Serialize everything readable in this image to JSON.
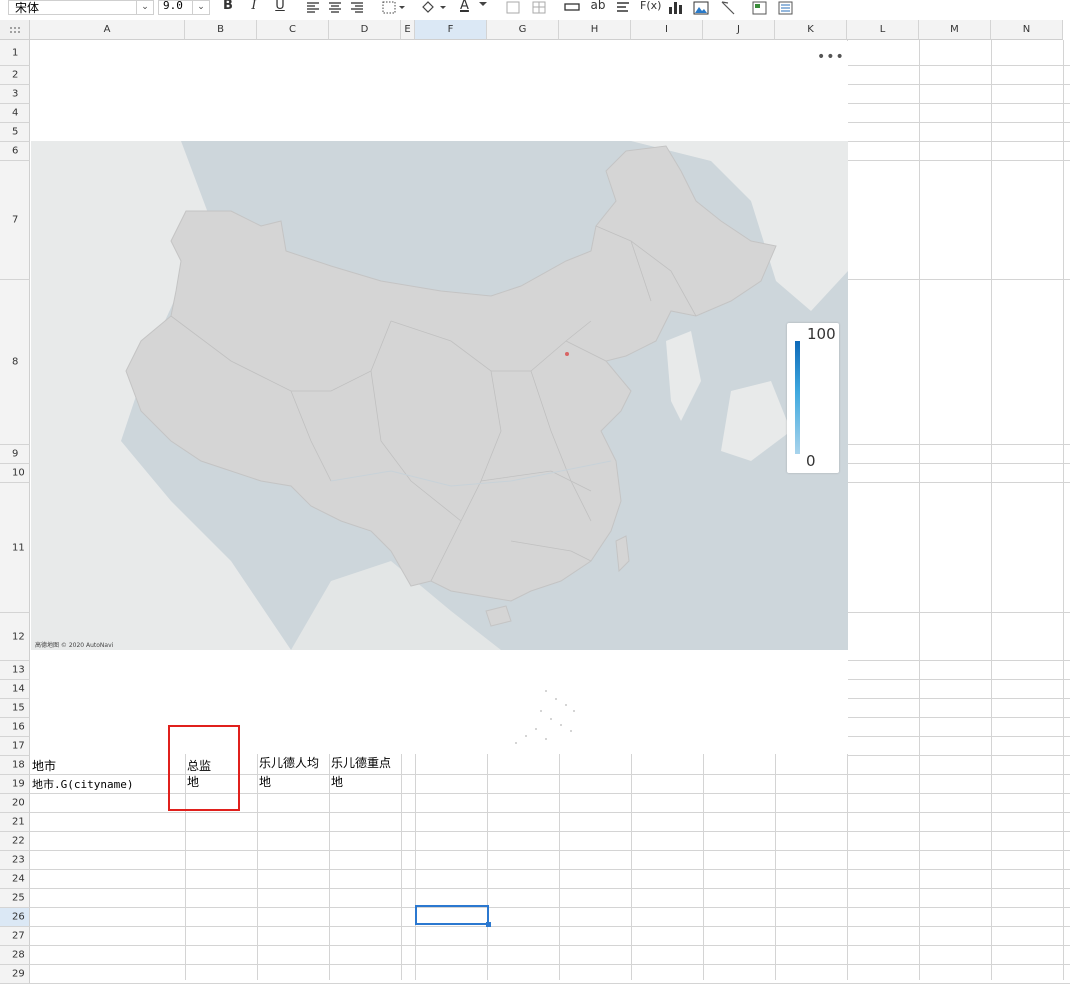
{
  "toolbar": {
    "font_name": "宋体",
    "font_size": "9.0",
    "bold_label": "B",
    "italic_label": "I",
    "underline_label": "U",
    "text_color_label": "A",
    "text_box_label": "ab",
    "formula_label": "F(x)",
    "icons": [
      "align-left-icon",
      "align-center-icon",
      "align-right-icon",
      "border-icon",
      "fill-color-icon",
      "text-color-icon",
      "merge-icon",
      "grid-icon",
      "text-field-icon",
      "text-box-icon",
      "formula-icon",
      "bar-chart-icon",
      "image-icon",
      "brush-icon",
      "insert-sheet-icon",
      "report-icon"
    ]
  },
  "columns": [
    "A",
    "B",
    "C",
    "D",
    "E",
    "F",
    "G",
    "H",
    "I",
    "J",
    "K",
    "L",
    "M",
    "N"
  ],
  "selected_column": "F",
  "rows": [
    "1",
    "2",
    "3",
    "4",
    "5",
    "6",
    "7",
    "8",
    "9",
    "10",
    "11",
    "12",
    "13",
    "14",
    "15",
    "16",
    "17",
    "18",
    "19",
    "20",
    "21",
    "22",
    "23",
    "24",
    "25",
    "26",
    "27",
    "28",
    "29"
  ],
  "selected_row": "26",
  "map_chart": {
    "more_icon": "•••",
    "legend_max": "100",
    "legend_min": "0",
    "attribution": "高德地图 © 2020 AutoNavi",
    "colors": {
      "land": "#d5d5d5",
      "sea": "#cdd6db",
      "foreign": "#e8eaea",
      "legend_top": "#0e69b8",
      "legend_bottom": "#a9d4ec"
    }
  },
  "cells": {
    "A18": "地市",
    "B18": "总监",
    "C18": "乐儿德人均",
    "D18": "乐儿德重点",
    "A19": "地市.G(cityname)",
    "B19": "地",
    "C19": "地",
    "D19": "地"
  },
  "highlight_color": "#e0201c",
  "selection_color": "#2b78d0"
}
